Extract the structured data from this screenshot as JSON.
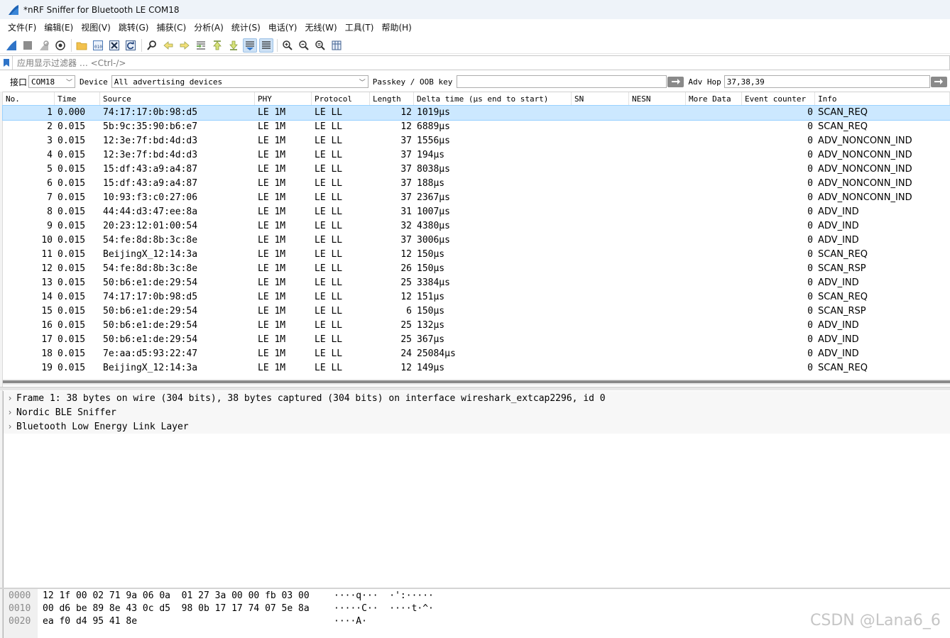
{
  "window": {
    "title": "*nRF Sniffer for Bluetooth LE COM18",
    "icon": "wireshark-fin-icon"
  },
  "menu": [
    "文件(F)",
    "编辑(E)",
    "视图(V)",
    "跳转(G)",
    "捕获(C)",
    "分析(A)",
    "统计(S)",
    "电话(Y)",
    "无线(W)",
    "工具(T)",
    "帮助(H)"
  ],
  "filter": {
    "placeholder": "应用显示过滤器 … <Ctrl-/>"
  },
  "interface_bar": {
    "interface_label": "接口",
    "interface_value": "COM18",
    "device_label": "Device",
    "device_value": "All advertising devices",
    "passkey_label": "Passkey / OOB key",
    "passkey_value": "",
    "adv_hop_label": "Adv Hop",
    "adv_hop_value": "37,38,39"
  },
  "packet_list": {
    "columns": [
      "No.",
      "Time",
      "Source",
      "PHY",
      "Protocol",
      "Length",
      "Delta time (µs end to start)",
      "SN",
      "NESN",
      "More Data",
      "Event counter",
      "Info"
    ],
    "rows": [
      {
        "no": "1",
        "time": "0.000",
        "source": "74:17:17:0b:98:d5",
        "phy": "LE 1M",
        "protocol": "LE LL",
        "length": "12",
        "delta": "1019µs",
        "event": "0",
        "info": "SCAN_REQ"
      },
      {
        "no": "2",
        "time": "0.015",
        "source": "5b:9c:35:90:b6:e7",
        "phy": "LE 1M",
        "protocol": "LE LL",
        "length": "12",
        "delta": "6889µs",
        "event": "0",
        "info": "SCAN_REQ"
      },
      {
        "no": "3",
        "time": "0.015",
        "source": "12:3e:7f:bd:4d:d3",
        "phy": "LE 1M",
        "protocol": "LE LL",
        "length": "37",
        "delta": "1556µs",
        "event": "0",
        "info": "ADV_NONCONN_IND"
      },
      {
        "no": "4",
        "time": "0.015",
        "source": "12:3e:7f:bd:4d:d3",
        "phy": "LE 1M",
        "protocol": "LE LL",
        "length": "37",
        "delta": "194µs",
        "event": "0",
        "info": "ADV_NONCONN_IND"
      },
      {
        "no": "5",
        "time": "0.015",
        "source": "15:df:43:a9:a4:87",
        "phy": "LE 1M",
        "protocol": "LE LL",
        "length": "37",
        "delta": "8038µs",
        "event": "0",
        "info": "ADV_NONCONN_IND"
      },
      {
        "no": "6",
        "time": "0.015",
        "source": "15:df:43:a9:a4:87",
        "phy": "LE 1M",
        "protocol": "LE LL",
        "length": "37",
        "delta": "188µs",
        "event": "0",
        "info": "ADV_NONCONN_IND"
      },
      {
        "no": "7",
        "time": "0.015",
        "source": "10:93:f3:c0:27:06",
        "phy": "LE 1M",
        "protocol": "LE LL",
        "length": "37",
        "delta": "2367µs",
        "event": "0",
        "info": "ADV_NONCONN_IND"
      },
      {
        "no": "8",
        "time": "0.015",
        "source": "44:44:d3:47:ee:8a",
        "phy": "LE 1M",
        "protocol": "LE LL",
        "length": "31",
        "delta": "1007µs",
        "event": "0",
        "info": "ADV_IND"
      },
      {
        "no": "9",
        "time": "0.015",
        "source": "20:23:12:01:00:54",
        "phy": "LE 1M",
        "protocol": "LE LL",
        "length": "32",
        "delta": "4380µs",
        "event": "0",
        "info": "ADV_IND"
      },
      {
        "no": "10",
        "time": "0.015",
        "source": "54:fe:8d:8b:3c:8e",
        "phy": "LE 1M",
        "protocol": "LE LL",
        "length": "37",
        "delta": "3006µs",
        "event": "0",
        "info": "ADV_IND"
      },
      {
        "no": "11",
        "time": "0.015",
        "source": "BeijingX_12:14:3a",
        "phy": "LE 1M",
        "protocol": "LE LL",
        "length": "12",
        "delta": "150µs",
        "event": "0",
        "info": "SCAN_REQ"
      },
      {
        "no": "12",
        "time": "0.015",
        "source": "54:fe:8d:8b:3c:8e",
        "phy": "LE 1M",
        "protocol": "LE LL",
        "length": "26",
        "delta": "150µs",
        "event": "0",
        "info": "SCAN_RSP"
      },
      {
        "no": "13",
        "time": "0.015",
        "source": "50:b6:e1:de:29:54",
        "phy": "LE 1M",
        "protocol": "LE LL",
        "length": "25",
        "delta": "3384µs",
        "event": "0",
        "info": "ADV_IND"
      },
      {
        "no": "14",
        "time": "0.015",
        "source": "74:17:17:0b:98:d5",
        "phy": "LE 1M",
        "protocol": "LE LL",
        "length": "12",
        "delta": "151µs",
        "event": "0",
        "info": "SCAN_REQ"
      },
      {
        "no": "15",
        "time": "0.015",
        "source": "50:b6:e1:de:29:54",
        "phy": "LE 1M",
        "protocol": "LE LL",
        "length": "6",
        "delta": "150µs",
        "event": "0",
        "info": "SCAN_RSP"
      },
      {
        "no": "16",
        "time": "0.015",
        "source": "50:b6:e1:de:29:54",
        "phy": "LE 1M",
        "protocol": "LE LL",
        "length": "25",
        "delta": "132µs",
        "event": "0",
        "info": "ADV_IND"
      },
      {
        "no": "17",
        "time": "0.015",
        "source": "50:b6:e1:de:29:54",
        "phy": "LE 1M",
        "protocol": "LE LL",
        "length": "25",
        "delta": "367µs",
        "event": "0",
        "info": "ADV_IND"
      },
      {
        "no": "18",
        "time": "0.015",
        "source": "7e:aa:d5:93:22:47",
        "phy": "LE 1M",
        "protocol": "LE LL",
        "length": "24",
        "delta": "25084µs",
        "event": "0",
        "info": "ADV_IND"
      },
      {
        "no": "19",
        "time": "0.015",
        "source": "BeijingX_12:14:3a",
        "phy": "LE 1M",
        "protocol": "LE LL",
        "length": "12",
        "delta": "149µs",
        "event": "0",
        "info": "SCAN_REQ"
      }
    ]
  },
  "details": [
    "Frame 1: 38 bytes on wire (304 bits), 38 bytes captured (304 bits) on interface wireshark_extcap2296, id 0",
    "Nordic BLE Sniffer",
    "Bluetooth Low Energy Link Layer"
  ],
  "bytes": [
    {
      "offset": "0000",
      "hex": "12 1f 00 02 71 9a 06 0a  01 27 3a 00 00 fb 03 00",
      "ascii": "····q···  ·':·····"
    },
    {
      "offset": "0010",
      "hex": "00 d6 be 89 8e 43 0c d5  98 0b 17 17 74 07 5e 8a",
      "ascii": "·····C··  ····t·^·"
    },
    {
      "offset": "0020",
      "hex": "ea f0 d4 95 41 8e",
      "ascii": "····A·"
    }
  ],
  "watermark": "CSDN @Lana6_6",
  "colors": {
    "selected_row": "#cce8ff",
    "titlebar": "#eef3f9"
  }
}
